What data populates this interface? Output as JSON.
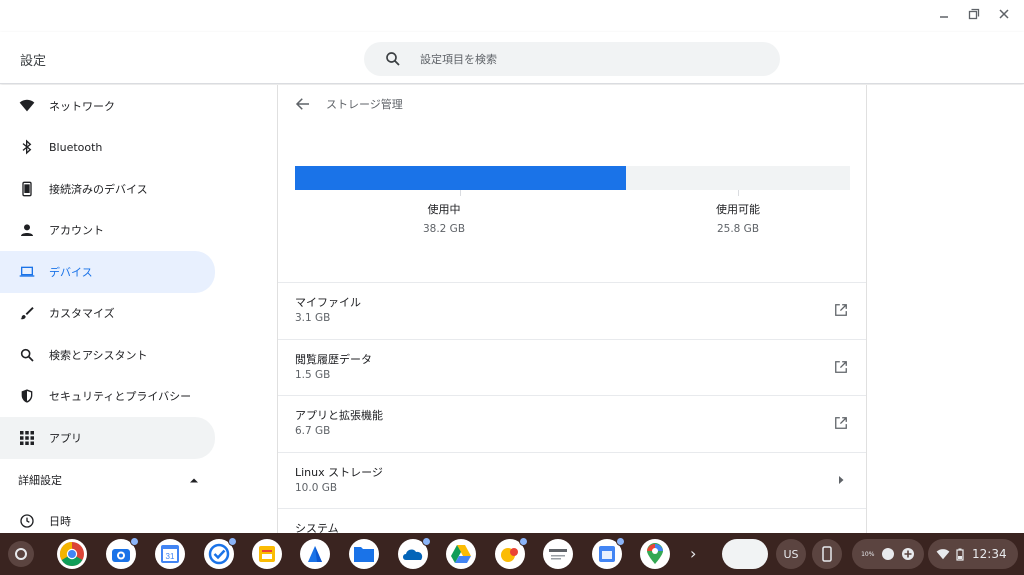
{
  "window": {
    "title": "設定"
  },
  "search": {
    "placeholder": "設定項目を検索"
  },
  "sidebar": {
    "items": [
      {
        "label": "ネットワーク",
        "icon": "wifi-icon"
      },
      {
        "label": "Bluetooth",
        "icon": "bluetooth-icon"
      },
      {
        "label": "接続済みのデバイス",
        "icon": "phone-icon"
      },
      {
        "label": "アカウント",
        "icon": "person-icon"
      },
      {
        "label": "デバイス",
        "icon": "laptop-icon",
        "selected": true
      },
      {
        "label": "カスタマイズ",
        "icon": "brush-icon"
      },
      {
        "label": "検索とアシスタント",
        "icon": "search-icon"
      },
      {
        "label": "セキュリティとプライバシー",
        "icon": "shield-icon"
      },
      {
        "label": "アプリ",
        "icon": "apps-grid-icon"
      }
    ],
    "advanced_label": "詳細設定",
    "advanced_items": [
      {
        "label": "日時",
        "icon": "clock-icon"
      }
    ]
  },
  "subpage": {
    "title": "ストレージ管理",
    "usage": {
      "used_label": "使用中",
      "used_value": "38.2 GB",
      "available_label": "使用可能",
      "available_value": "25.8 GB",
      "used_fraction": 0.597
    },
    "rows": [
      {
        "title": "マイファイル",
        "subtitle": "3.1 GB",
        "action": "open-in-new-icon"
      },
      {
        "title": "閲覧履歴データ",
        "subtitle": "1.5 GB",
        "action": "open-in-new-icon"
      },
      {
        "title": "アプリと拡張機能",
        "subtitle": "6.7 GB",
        "action": "open-in-new-icon"
      },
      {
        "title": "Linux ストレージ",
        "subtitle": "10.0 GB",
        "action": "arrow-right-icon"
      },
      {
        "title": "システム",
        "subtitle": "",
        "action": ""
      }
    ]
  },
  "shelf": {
    "ime_label": "US",
    "time": "12:34",
    "battery_label": "10%",
    "apps": [
      "chrome-icon",
      "camera-icon",
      "calendar-icon",
      "tasks-icon",
      "keep-icon",
      "maps-pin-icon",
      "files-icon",
      "onedrive-icon",
      "drive-icon",
      "photos-icon",
      "news-icon",
      "docs-icon",
      "google-maps-icon"
    ],
    "calendar_day": "31"
  },
  "colors": {
    "accent": "#1a73e8",
    "selected_bg": "#e8f0fe",
    "shelf_bg": "#3a2420"
  }
}
